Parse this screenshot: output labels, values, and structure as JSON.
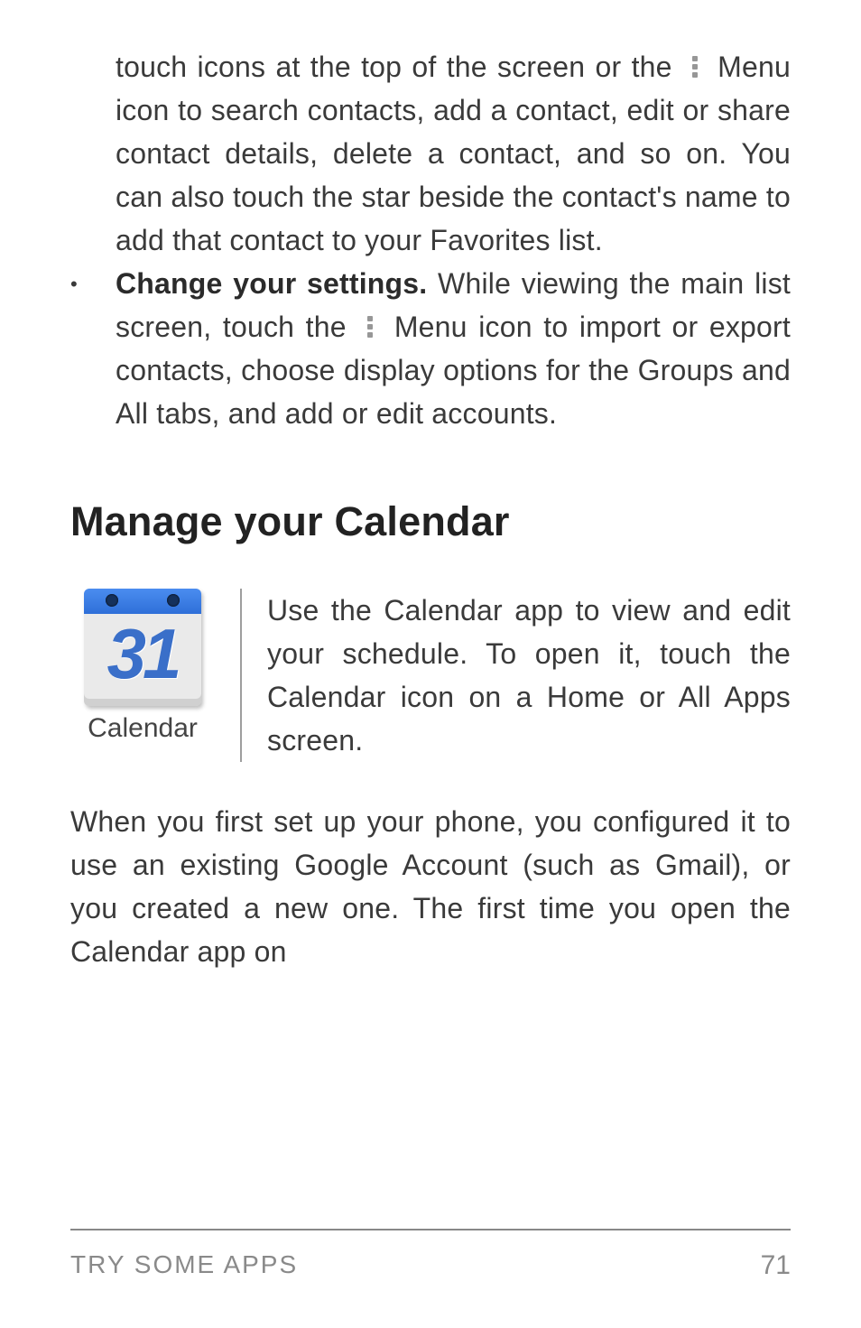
{
  "body": {
    "cont_a": "touch icons at the top of the screen or the ",
    "cont_b": " Menu icon to search contacts, add a contact, edit or share contact details, delete a contact, and so on. You can also touch the star beside the contact's name to add that contact to your Favorites list.",
    "bullet": {
      "marker": "•",
      "bold": "Change your settings.",
      "text_a": " While viewing the main list screen, touch the ",
      "text_b": " Menu icon to import or export contacts, choose display options for the Groups and All tabs, and add or edit accounts."
    }
  },
  "heading": "Manage your Calendar",
  "calendar": {
    "icon_number": "31",
    "caption": "Calendar",
    "intro": "Use the Calendar app to view and edit your schedule. To open it, touch the Calendar icon on a Home or All Apps screen."
  },
  "para_after": "When you first set up your phone, you configured it to use an existing Google Account (such as Gmail), or you created a new one. The first time you open the Calendar app on",
  "footer": {
    "section": "TRY SOME APPS",
    "page": "71"
  }
}
